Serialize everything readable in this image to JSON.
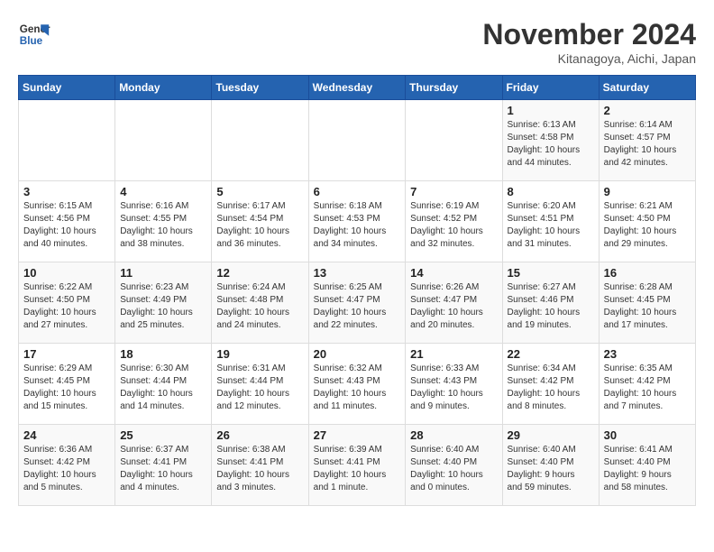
{
  "logo": {
    "line1": "General",
    "line2": "Blue"
  },
  "title": "November 2024",
  "location": "Kitanagoya, Aichi, Japan",
  "weekdays": [
    "Sunday",
    "Monday",
    "Tuesday",
    "Wednesday",
    "Thursday",
    "Friday",
    "Saturday"
  ],
  "weeks": [
    [
      {
        "day": "",
        "info": ""
      },
      {
        "day": "",
        "info": ""
      },
      {
        "day": "",
        "info": ""
      },
      {
        "day": "",
        "info": ""
      },
      {
        "day": "",
        "info": ""
      },
      {
        "day": "1",
        "info": "Sunrise: 6:13 AM\nSunset: 4:58 PM\nDaylight: 10 hours\nand 44 minutes."
      },
      {
        "day": "2",
        "info": "Sunrise: 6:14 AM\nSunset: 4:57 PM\nDaylight: 10 hours\nand 42 minutes."
      }
    ],
    [
      {
        "day": "3",
        "info": "Sunrise: 6:15 AM\nSunset: 4:56 PM\nDaylight: 10 hours\nand 40 minutes."
      },
      {
        "day": "4",
        "info": "Sunrise: 6:16 AM\nSunset: 4:55 PM\nDaylight: 10 hours\nand 38 minutes."
      },
      {
        "day": "5",
        "info": "Sunrise: 6:17 AM\nSunset: 4:54 PM\nDaylight: 10 hours\nand 36 minutes."
      },
      {
        "day": "6",
        "info": "Sunrise: 6:18 AM\nSunset: 4:53 PM\nDaylight: 10 hours\nand 34 minutes."
      },
      {
        "day": "7",
        "info": "Sunrise: 6:19 AM\nSunset: 4:52 PM\nDaylight: 10 hours\nand 32 minutes."
      },
      {
        "day": "8",
        "info": "Sunrise: 6:20 AM\nSunset: 4:51 PM\nDaylight: 10 hours\nand 31 minutes."
      },
      {
        "day": "9",
        "info": "Sunrise: 6:21 AM\nSunset: 4:50 PM\nDaylight: 10 hours\nand 29 minutes."
      }
    ],
    [
      {
        "day": "10",
        "info": "Sunrise: 6:22 AM\nSunset: 4:50 PM\nDaylight: 10 hours\nand 27 minutes."
      },
      {
        "day": "11",
        "info": "Sunrise: 6:23 AM\nSunset: 4:49 PM\nDaylight: 10 hours\nand 25 minutes."
      },
      {
        "day": "12",
        "info": "Sunrise: 6:24 AM\nSunset: 4:48 PM\nDaylight: 10 hours\nand 24 minutes."
      },
      {
        "day": "13",
        "info": "Sunrise: 6:25 AM\nSunset: 4:47 PM\nDaylight: 10 hours\nand 22 minutes."
      },
      {
        "day": "14",
        "info": "Sunrise: 6:26 AM\nSunset: 4:47 PM\nDaylight: 10 hours\nand 20 minutes."
      },
      {
        "day": "15",
        "info": "Sunrise: 6:27 AM\nSunset: 4:46 PM\nDaylight: 10 hours\nand 19 minutes."
      },
      {
        "day": "16",
        "info": "Sunrise: 6:28 AM\nSunset: 4:45 PM\nDaylight: 10 hours\nand 17 minutes."
      }
    ],
    [
      {
        "day": "17",
        "info": "Sunrise: 6:29 AM\nSunset: 4:45 PM\nDaylight: 10 hours\nand 15 minutes."
      },
      {
        "day": "18",
        "info": "Sunrise: 6:30 AM\nSunset: 4:44 PM\nDaylight: 10 hours\nand 14 minutes."
      },
      {
        "day": "19",
        "info": "Sunrise: 6:31 AM\nSunset: 4:44 PM\nDaylight: 10 hours\nand 12 minutes."
      },
      {
        "day": "20",
        "info": "Sunrise: 6:32 AM\nSunset: 4:43 PM\nDaylight: 10 hours\nand 11 minutes."
      },
      {
        "day": "21",
        "info": "Sunrise: 6:33 AM\nSunset: 4:43 PM\nDaylight: 10 hours\nand 9 minutes."
      },
      {
        "day": "22",
        "info": "Sunrise: 6:34 AM\nSunset: 4:42 PM\nDaylight: 10 hours\nand 8 minutes."
      },
      {
        "day": "23",
        "info": "Sunrise: 6:35 AM\nSunset: 4:42 PM\nDaylight: 10 hours\nand 7 minutes."
      }
    ],
    [
      {
        "day": "24",
        "info": "Sunrise: 6:36 AM\nSunset: 4:42 PM\nDaylight: 10 hours\nand 5 minutes."
      },
      {
        "day": "25",
        "info": "Sunrise: 6:37 AM\nSunset: 4:41 PM\nDaylight: 10 hours\nand 4 minutes."
      },
      {
        "day": "26",
        "info": "Sunrise: 6:38 AM\nSunset: 4:41 PM\nDaylight: 10 hours\nand 3 minutes."
      },
      {
        "day": "27",
        "info": "Sunrise: 6:39 AM\nSunset: 4:41 PM\nDaylight: 10 hours\nand 1 minute."
      },
      {
        "day": "28",
        "info": "Sunrise: 6:40 AM\nSunset: 4:40 PM\nDaylight: 10 hours\nand 0 minutes."
      },
      {
        "day": "29",
        "info": "Sunrise: 6:40 AM\nSunset: 4:40 PM\nDaylight: 9 hours\nand 59 minutes."
      },
      {
        "day": "30",
        "info": "Sunrise: 6:41 AM\nSunset: 4:40 PM\nDaylight: 9 hours\nand 58 minutes."
      }
    ]
  ]
}
